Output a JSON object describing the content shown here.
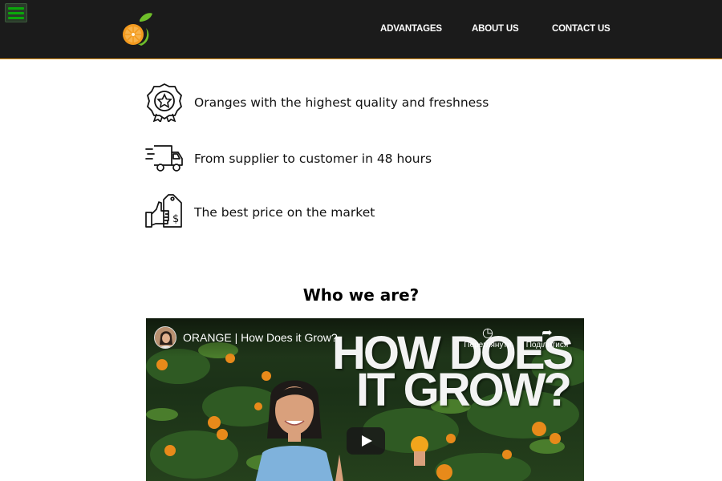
{
  "nav": {
    "items": [
      {
        "label": "ADVANTAGES"
      },
      {
        "label": "ABOUT US"
      },
      {
        "label": "CONTACT US"
      }
    ]
  },
  "features": [
    {
      "icon": "quality-badge-icon",
      "text": "Oranges with the highest quality and freshness"
    },
    {
      "icon": "delivery-truck-icon",
      "text": "From supplier to customer in 48 hours"
    },
    {
      "icon": "price-tag-thumbs-up-icon",
      "text": "The best price on the market"
    }
  ],
  "about": {
    "title": "Who we are?"
  },
  "video": {
    "title": "ORANGE | How Does it Grow?",
    "headline_line1": "HOW DOES",
    "headline_line2": "IT GROW?",
    "watch_later_label": "Переглянути",
    "share_label": "Поділитися"
  },
  "colors": {
    "header_bg": "#1b1b1b",
    "header_border": "#f3a01c",
    "burger_bars": "#0aa80a",
    "orange": "#f39a1e",
    "leaf": "#6fbf2a"
  }
}
